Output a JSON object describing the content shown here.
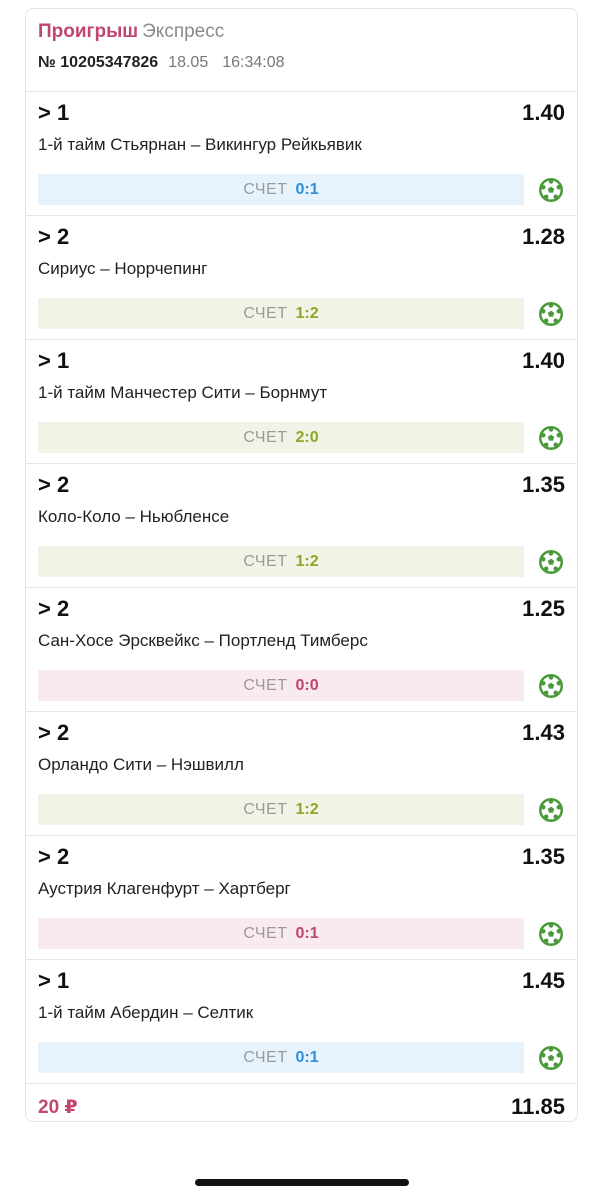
{
  "header": {
    "status": "Проигрыш",
    "type": "Экспресс",
    "number": "№ 10205347826",
    "date": "18.05",
    "time": "16:34:08"
  },
  "score_label": "СЧЕТ",
  "bets": [
    {
      "pick": "> 1",
      "odd": "1.40",
      "match": "1-й тайм Стьярнан – Викингур Рейкьявик",
      "score": "0:1",
      "color": "blue",
      "icon": "soccer-ball-icon"
    },
    {
      "pick": "> 2",
      "odd": "1.28",
      "match": "Сириус – Норрчепинг",
      "score": "1:2",
      "color": "green",
      "icon": "soccer-ball-icon"
    },
    {
      "pick": "> 1",
      "odd": "1.40",
      "match": "1-й тайм Манчестер Сити – Борнмут",
      "score": "2:0",
      "color": "green",
      "icon": "soccer-ball-icon"
    },
    {
      "pick": "> 2",
      "odd": "1.35",
      "match": "Коло-Коло – Ньюбленсе",
      "score": "1:2",
      "color": "green",
      "icon": "soccer-ball-icon"
    },
    {
      "pick": "> 2",
      "odd": "1.25",
      "match": "Сан-Хосе Эрсквейкс – Портленд Тимберс",
      "score": "0:0",
      "color": "red",
      "icon": "soccer-ball-icon"
    },
    {
      "pick": "> 2",
      "odd": "1.43",
      "match": "Орландо Сити – Нэшвилл",
      "score": "1:2",
      "color": "green",
      "icon": "soccer-ball-icon"
    },
    {
      "pick": "> 2",
      "odd": "1.35",
      "match": "Аустрия Клагенфурт – Хартберг",
      "score": "0:1",
      "color": "red",
      "icon": "soccer-ball-icon"
    },
    {
      "pick": "> 1",
      "odd": "1.45",
      "match": "1-й тайм Абердин – Селтик",
      "score": "0:1",
      "color": "blue",
      "icon": "soccer-ball-icon"
    }
  ],
  "footer": {
    "stake": "20 ₽",
    "total_odd": "11.85"
  },
  "colors": {
    "loss": "#c2456b",
    "score_blue": "#2f8ed8",
    "score_green": "#8aa82a",
    "ball_green": "#4a9a3a"
  }
}
